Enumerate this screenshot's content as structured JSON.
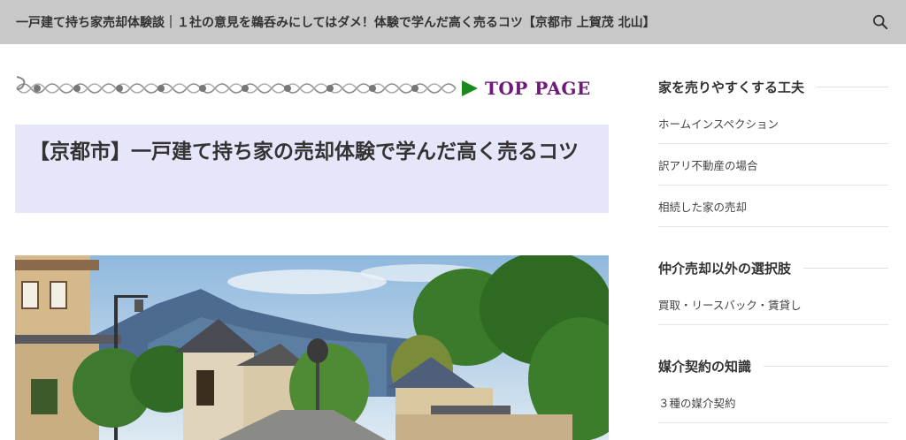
{
  "header": {
    "site_title": "一戸建て持ち家売却体験談｜１社の意見を鵜呑みにしてはダメ！体験で学んだ高く売るコツ【京都市 上賀茂 北山】",
    "search_icon": "search-icon"
  },
  "main": {
    "top_page_label": "TOP PAGE",
    "article_title": "【京都市】一戸建て持ち家の売却体験で学んだ高く売るコツ"
  },
  "sidebar": {
    "widgets": [
      {
        "title": "家を売りやすくする工夫",
        "links": [
          "ホームインスペクション",
          "訳アリ不動産の場合",
          "相続した家の売却"
        ]
      },
      {
        "title": "仲介売却以外の選択肢",
        "links": [
          "買取・リースバック・賃貸し"
        ]
      },
      {
        "title": "媒介契約の知識",
        "links": [
          "３種の媒介契約"
        ]
      }
    ]
  },
  "colors": {
    "header_bg": "#c8c8c8",
    "title_box_bg": "#e6e6fa",
    "top_page_text": "#6e1a78",
    "top_page_arrow": "#1a8a1a"
  }
}
